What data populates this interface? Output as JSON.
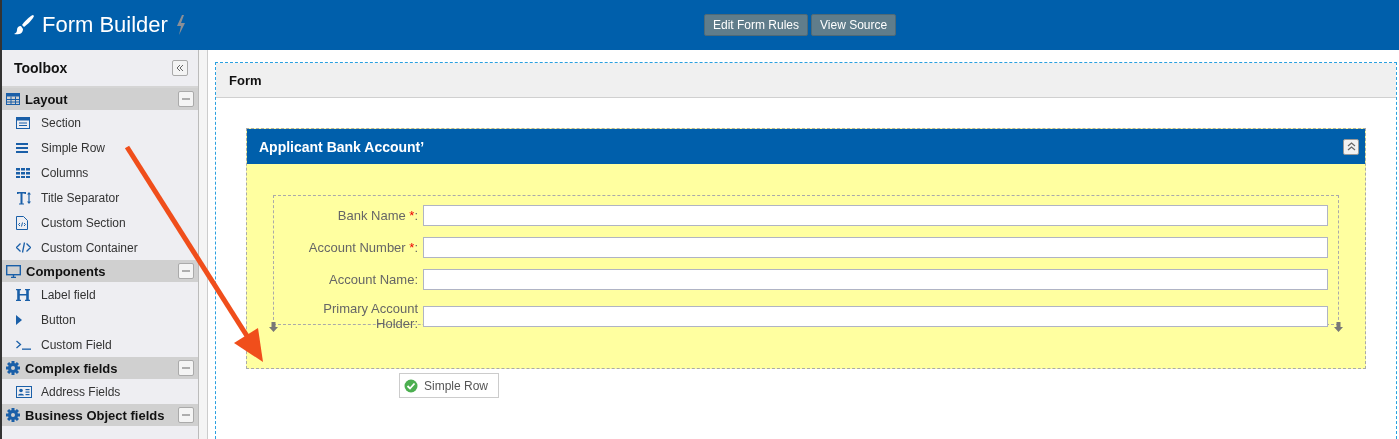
{
  "header": {
    "title": "Form Builder",
    "buttons": [
      "Edit Form Rules",
      "View Source"
    ]
  },
  "toolbox": {
    "title": "Toolbox",
    "groups": [
      {
        "label": "Layout",
        "expanded": true,
        "items": [
          {
            "label": "Section"
          },
          {
            "label": "Simple Row"
          },
          {
            "label": "Columns"
          },
          {
            "label": "Title Separator"
          },
          {
            "label": "Custom Section"
          },
          {
            "label": "Custom Container"
          }
        ]
      },
      {
        "label": "Components",
        "expanded": true,
        "items": [
          {
            "label": "Label field"
          },
          {
            "label": "Button"
          },
          {
            "label": "Custom Field"
          }
        ]
      },
      {
        "label": "Complex fields",
        "expanded": true,
        "items": [
          {
            "label": "Address Fields"
          }
        ]
      },
      {
        "label": "Business Object fields",
        "expanded": true
      }
    ]
  },
  "form": {
    "title": "Form",
    "section": {
      "title": "Applicant Bank Account’",
      "expanded": true,
      "fields": [
        {
          "label": "Bank Name",
          "required": true,
          "marker": "*",
          "colon": ":"
        },
        {
          "label": "Account Number",
          "required": true,
          "marker": "*",
          "colon": ":"
        },
        {
          "label": "Account Name",
          "required": false,
          "colon": ":"
        },
        {
          "label": "Primary Account Holder",
          "required": false,
          "colon": ":"
        }
      ]
    }
  },
  "drag_helper": {
    "label": "Simple Row"
  }
}
